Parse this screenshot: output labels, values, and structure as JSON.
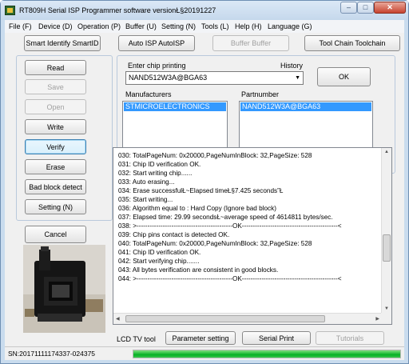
{
  "window": {
    "title": "RT809H Serial ISP Programmer software versionŁ§20191227",
    "controls": {
      "minimize": "–",
      "maximize": "□",
      "close": "✕"
    }
  },
  "menu": [
    "File (F)",
    "Device (D)",
    "Operation (P)",
    "Buffer (U)",
    "Setting (N)",
    "Tools (L)",
    "Help (H)",
    "Language (G)"
  ],
  "toolbar": {
    "smart_identify": "Smart Identify SmartID",
    "auto_isp": "Auto ISP AutoISP",
    "buffer": "Buffer Buffer",
    "tool_chain": "Tool Chain Toolchain"
  },
  "actions": {
    "read": "Read",
    "save": "Save",
    "open": "Open",
    "write": "Write",
    "verify": "Verify",
    "erase": "Erase",
    "bad_block": "Bad block detect",
    "setting": "Setting (N)",
    "cancel": "Cancel"
  },
  "chip": {
    "printing_label": "Enter chip printing",
    "history_label": "History",
    "value": "NAND512W3A@BGA63",
    "ok": "OK",
    "manufacturers_label": "Manufacturers",
    "partnumber_label": "Partnumber",
    "manufacturer_selected": "STMICROELECTRONICS",
    "partnumber_selected": "NAND512W3A@BGA63"
  },
  "log": [
    "030:  TotalPageNum: 0x20000,PageNumInBlock: 32,PageSize: 528",
    "031:  Chip ID verification OK.",
    "032:  Start writing chip......",
    "033:  Auto erasing...",
    "034:  Erase successfulŁ~Elapsed timeŁ§7.425 seconds”Ł",
    "035:  Start writing...",
    "036:  Algorithm equal to : Hard Copy (Ignore bad block)",
    "037:  Elapsed time: 29.99 secondsŁ~average speed of 4614811 bytes/sec.",
    "038:  >--------------------------------------------OK--------------------------------------------<",
    "039:  Chip pins contact is detected OK.",
    "040:  TotalPageNum: 0x20000,PageNumInBlock: 32,PageSize: 528",
    "041:  Chip ID verification OK.",
    "042:  Start verifying chip.......",
    "043:  All bytes verification are consistent in good blocks.",
    "044:  >--------------------------------------------OK--------------------------------------------<"
  ],
  "bottom": {
    "lcd_label": "LCD TV tool",
    "parameter_setting": "Parameter setting",
    "serial_print": "Serial Print",
    "tutorials": "Tutorials"
  },
  "status": {
    "serial": "SN:20171111174337-024375",
    "progress": 1.0,
    "progress_color": "#06b025"
  },
  "colors": {
    "accent": "#3399ff",
    "chrome": "#c9dcee"
  }
}
